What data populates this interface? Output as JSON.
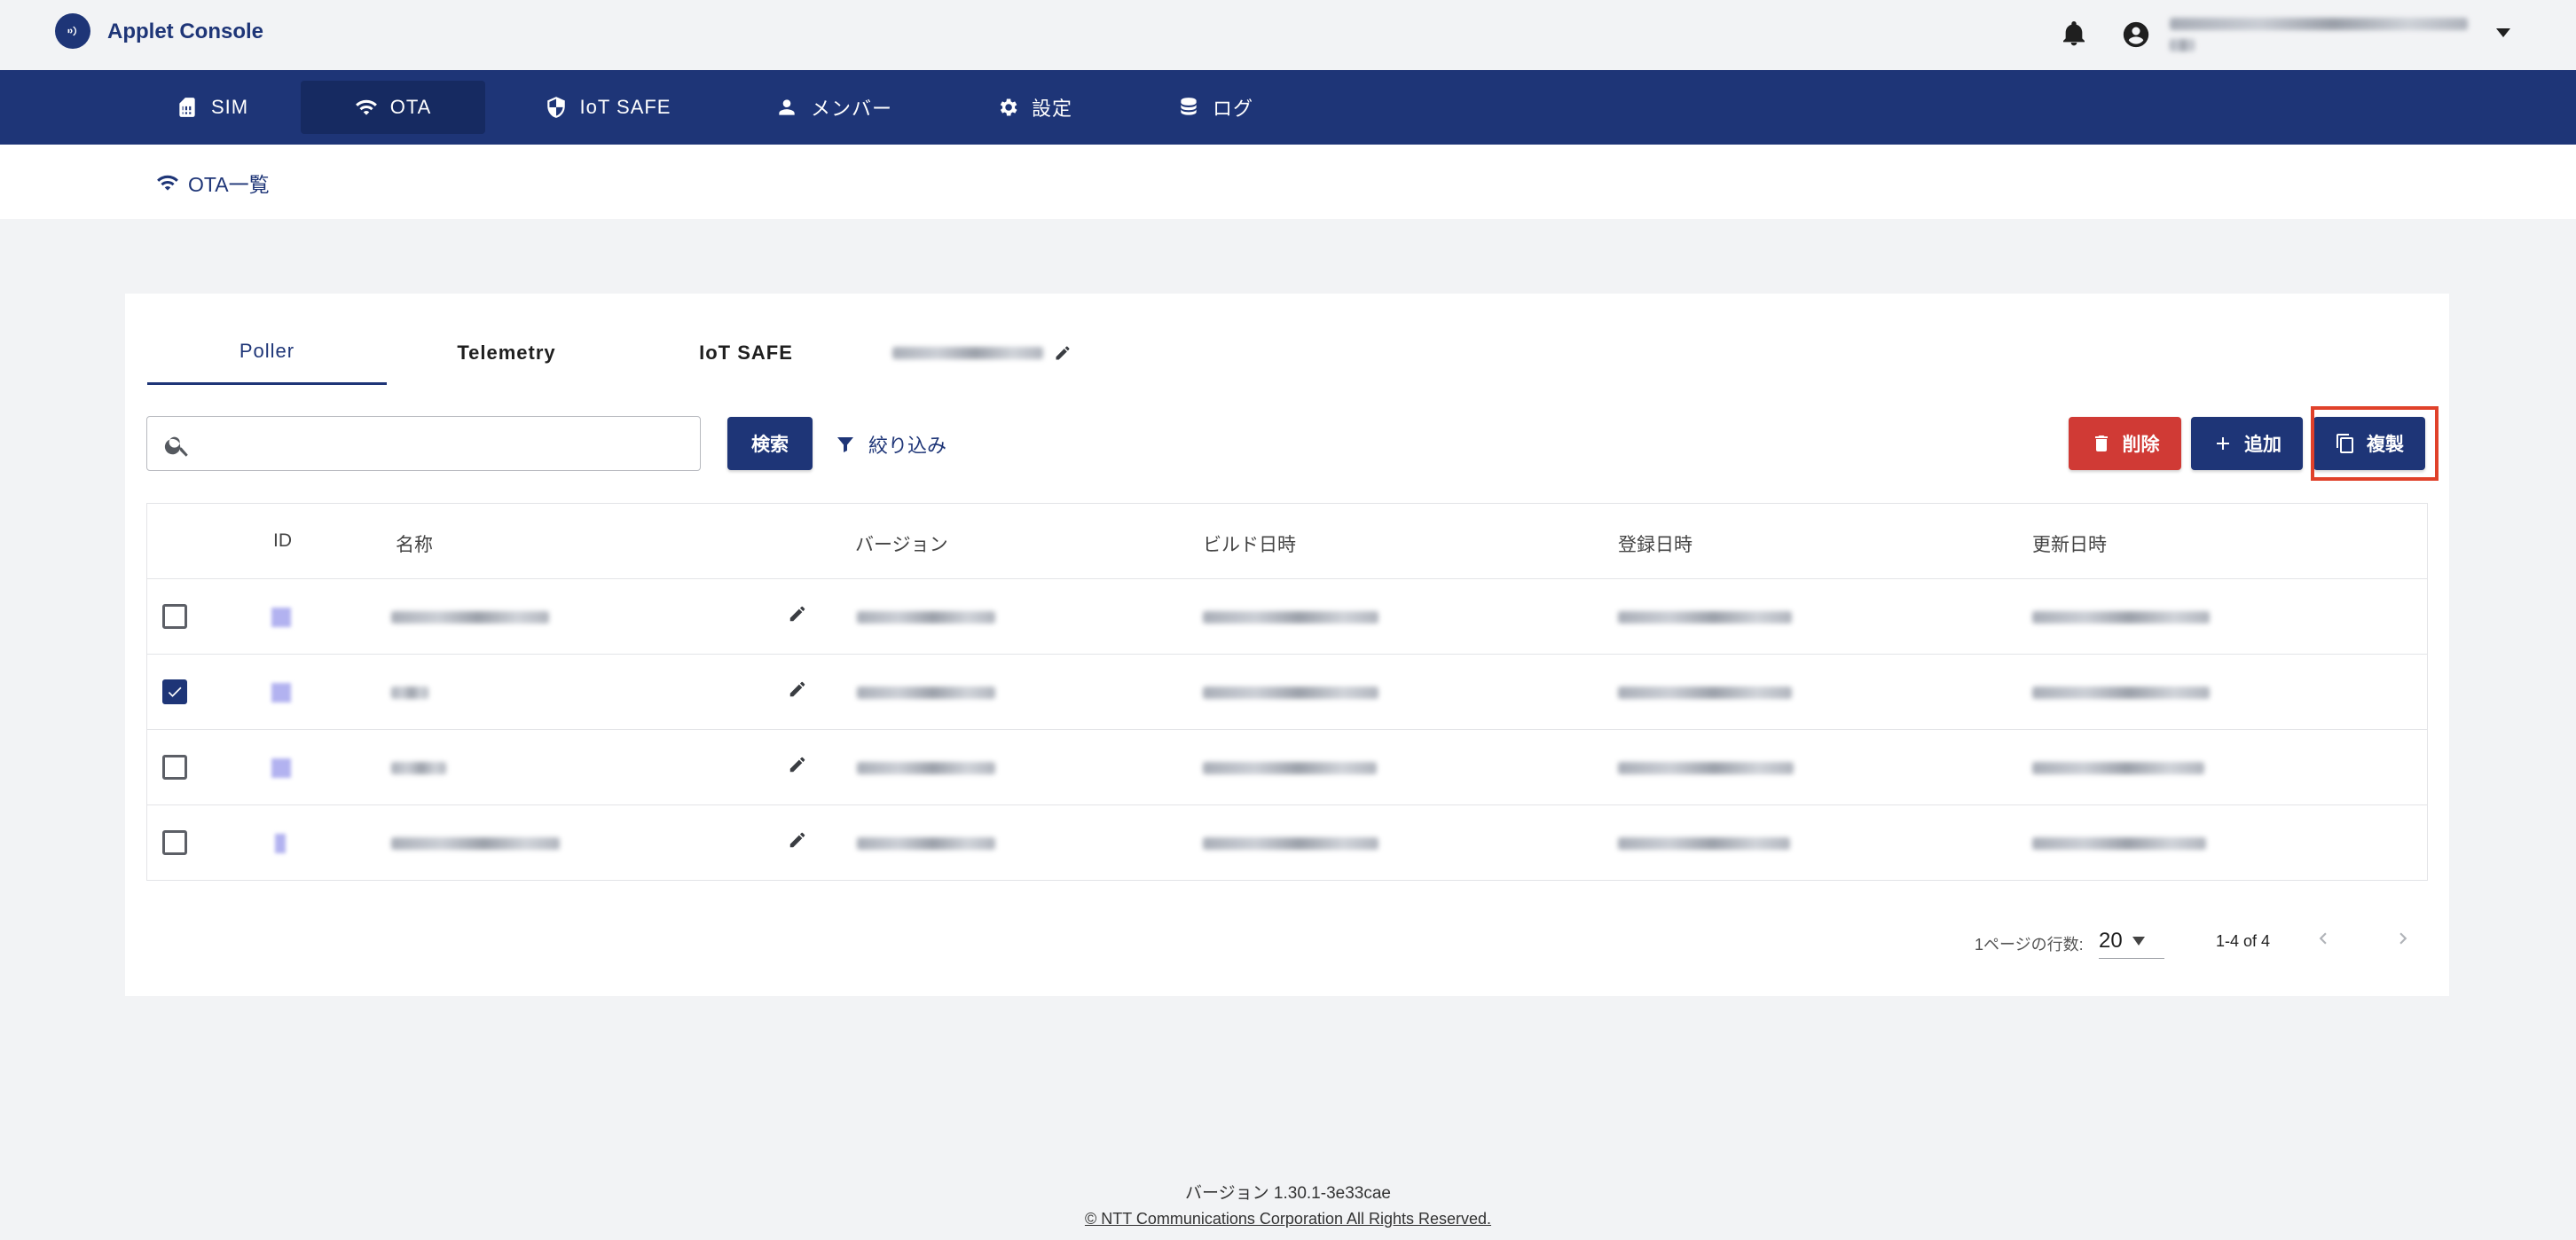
{
  "app": {
    "title": "Applet Console"
  },
  "nav": {
    "items": [
      {
        "label": "SIM",
        "icon": "sim-card-icon"
      },
      {
        "label": "OTA",
        "icon": "wifi-icon",
        "active": true
      },
      {
        "label": "IoT SAFE",
        "icon": "shield-icon"
      },
      {
        "label": "メンバー",
        "icon": "person-icon"
      },
      {
        "label": "設定",
        "icon": "gear-icon"
      },
      {
        "label": "ログ",
        "icon": "database-icon"
      }
    ]
  },
  "breadcrumb": {
    "label": "OTA一覧"
  },
  "tabs": [
    {
      "label": "Poller",
      "active": true
    },
    {
      "label": "Telemetry"
    },
    {
      "label": "IoT SAFE"
    }
  ],
  "toolbar": {
    "search_placeholder": "",
    "search_label": "検索",
    "filter_label": "絞り込み",
    "delete_label": "削除",
    "add_label": "追加",
    "copy_label": "複製"
  },
  "table": {
    "headers": [
      "ID",
      "名称",
      "バージョン",
      "ビルド日時",
      "登録日時",
      "更新日時"
    ],
    "rows": [
      {
        "checked": false
      },
      {
        "checked": true
      },
      {
        "checked": false
      },
      {
        "checked": false
      }
    ]
  },
  "pagination": {
    "rows_per_page_label": "1ページの行数:",
    "rows_per_page": "20",
    "range": "1-4 of 4"
  },
  "footer": {
    "version": "バージョン 1.30.1-3e33cae",
    "copyright": "© NTT Communications Corporation All Rights Reserved."
  },
  "colors": {
    "primary": "#1e3577",
    "danger": "#d03a35",
    "highlight": "#e0412a",
    "background": "#f2f3f5"
  }
}
